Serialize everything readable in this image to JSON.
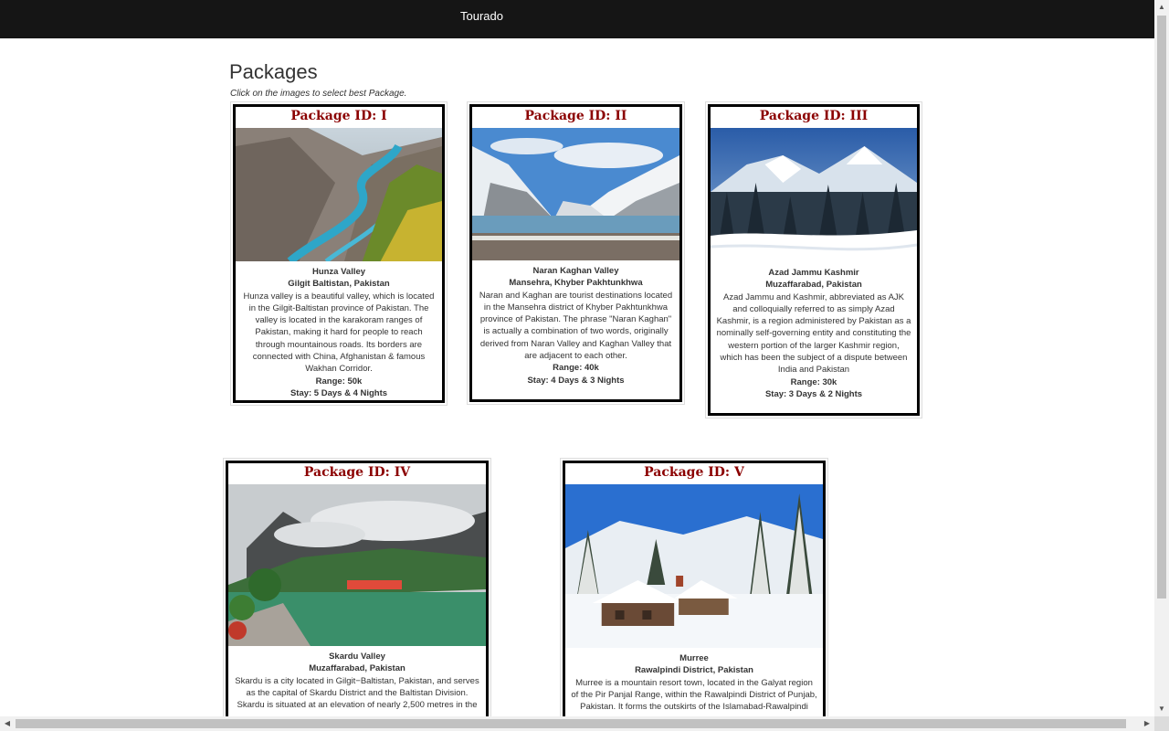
{
  "navbar": {
    "brand": "Tourado"
  },
  "page": {
    "title": "Packages",
    "subtitle": "Click on the images to select best Package."
  },
  "packages": [
    {
      "id_label": "Package ID: I",
      "name": "Hunza Valley",
      "location": "Gilgit Baltistan, Pakistan",
      "description": "Hunza valley is a beautiful valley, which is located in the Gilgit-Baltistan province of Pakistan. The valley is located in the karakoram ranges of Pakistan, making it hard for people to reach through mountainous roads. Its borders are connected with China, Afghanistan & famous Wakhan Corridor.",
      "range": "Range: 50k",
      "stay": "Stay: 5 Days & 4 Nights"
    },
    {
      "id_label": "Package ID: II",
      "name": "Naran Kaghan Valley",
      "location": "Mansehra, Khyber Pakhtunkhwa",
      "description": "Naran and Kaghan are tourist destinations located in the Mansehra district of Khyber Pakhtunkhwa province of Pakistan. The phrase \"Naran Kaghan\" is actually a combination of two words, originally derived from Naran Valley and Kaghan Valley that are adjacent to each other.",
      "range": "Range: 40k",
      "stay": "Stay: 4 Days & 3 Nights"
    },
    {
      "id_label": "Package ID: III",
      "name": "Azad Jammu Kashmir",
      "location": "Muzaffarabad, Pakistan",
      "description": "Azad Jammu and Kashmir, abbreviated as AJK and colloquially referred to as simply Azad Kashmir, is a region administered by Pakistan as a nominally self-governing entity and constituting the western portion of the larger Kashmir region, which has been the subject of a dispute between India and Pakistan",
      "range": "Range: 30k",
      "stay": "Stay: 3 Days & 2 Nights"
    },
    {
      "id_label": "Package ID: IV",
      "name": "Skardu Valley",
      "location": "Muzaffarabad, Pakistan",
      "description": "Skardu is a city located in Gilgit−Baltistan, Pakistan, and serves as the capital of Skardu District and the Baltistan Division. Skardu is situated at an elevation of nearly 2,500 metres in the",
      "range": "",
      "stay": ""
    },
    {
      "id_label": "Package ID: V",
      "name": "Murree",
      "location": "Rawalpindi District, Pakistan",
      "description": "Murree is a mountain resort town, located in the Galyat region of the Pir Panjal Range, within the Rawalpindi District of Punjab, Pakistan. It forms the outskirts of the Islamabad-Rawalpindi",
      "range": "",
      "stay": ""
    }
  ],
  "icons": {
    "scroll_up": "triangle-up",
    "scroll_down": "triangle-down",
    "scroll_left": "triangle-left",
    "scroll_right": "triangle-right"
  },
  "colors": {
    "navbar_bg": "#151515",
    "package_title": "#8b0000"
  }
}
